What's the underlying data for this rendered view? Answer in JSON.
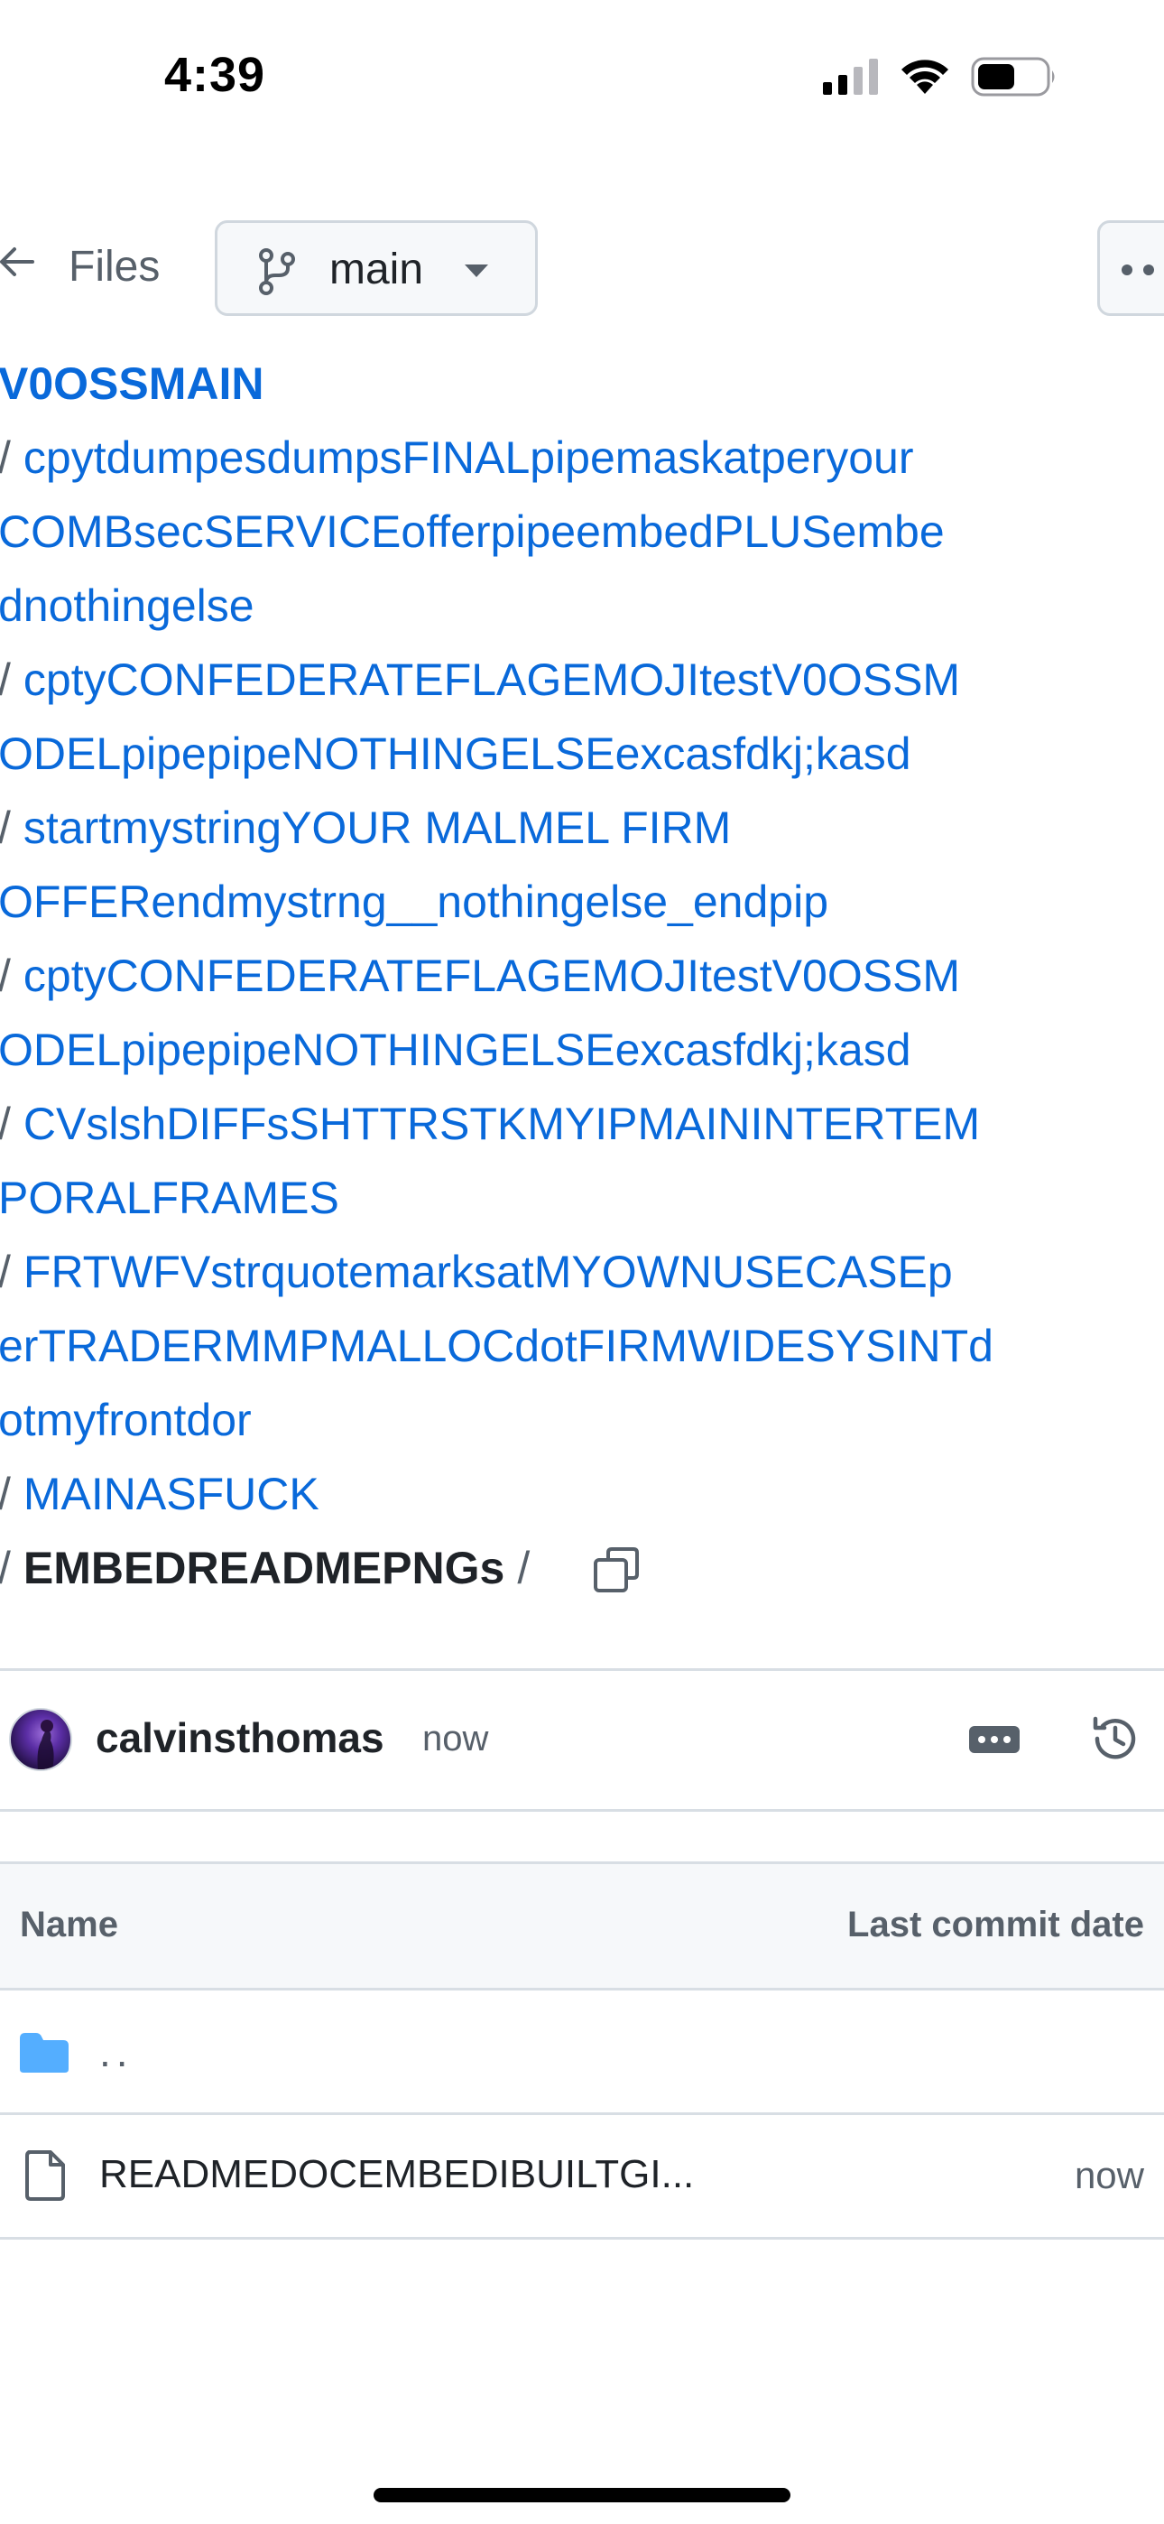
{
  "status_bar": {
    "time": "4:39",
    "icons": [
      "cellular-signal-icon",
      "wifi-icon",
      "battery-icon"
    ]
  },
  "toolbar": {
    "back_icon": "arrow-left-icon",
    "files_label": "Files",
    "branch_icon": "git-branch-icon",
    "branch_name": "main",
    "branch_caret": "caret-down-icon",
    "more_icon": "kebab-horizontal-icon"
  },
  "breadcrumb": {
    "lines": [
      {
        "sep": "",
        "text": "V0OSSMAIN",
        "kind": "root"
      },
      {
        "sep": "/",
        "text": "cpytdumpesdumpsFINALpipemaskatperyour",
        "kind": "link"
      },
      {
        "sep": "",
        "text": "COMBsecSERVICEofferpipeembedPLUSembe",
        "kind": "link"
      },
      {
        "sep": "",
        "text": "dnothingelse",
        "kind": "link"
      },
      {
        "sep": "/",
        "text": "cptyCONFEDERATEFLAGEMOJItestV0OSSM",
        "kind": "link"
      },
      {
        "sep": "",
        "text": "ODELpipepipeNOTHINGELSEexcasfdkj;kasd",
        "kind": "link"
      },
      {
        "sep": "/",
        "text": "startmystringYOUR MALMEL FIRM",
        "kind": "link"
      },
      {
        "sep": "",
        "text": "OFFERendmystrng__nothingelse_endpip",
        "kind": "link"
      },
      {
        "sep": "/",
        "text": "cptyCONFEDERATEFLAGEMOJItestV0OSSM",
        "kind": "link"
      },
      {
        "sep": "",
        "text": "ODELpipepipeNOTHINGELSEexcasfdkj;kasd",
        "kind": "link"
      },
      {
        "sep": "/",
        "text": "CVslshDIFFsSHTTRSTKMYIPMAININTERTEM",
        "kind": "link"
      },
      {
        "sep": "",
        "text": "PORALFRAMES",
        "kind": "link"
      },
      {
        "sep": "/",
        "text": "FRTWFVstrquotemarksatMYOWNUSECASEp",
        "kind": "link"
      },
      {
        "sep": "",
        "text": "erTRADERMMPMALLOCdotFIRMWIDESYSINTd",
        "kind": "link"
      },
      {
        "sep": "",
        "text": "otmyfrontdor",
        "kind": "link"
      },
      {
        "sep": "/",
        "text": "MAINASFUCK",
        "kind": "link"
      },
      {
        "sep": "/",
        "text": "EMBEDREADMEPNGs",
        "kind": "current",
        "trailing_sep": "/"
      }
    ],
    "copy_icon": "copy-icon"
  },
  "commit": {
    "avatar": "avatar",
    "author": "calvinsthomas",
    "time": "now",
    "ellipsis_icon": "ellipsis-icon",
    "history_icon": "history-icon"
  },
  "table": {
    "headers": {
      "name": "Name",
      "date": "Last commit date"
    },
    "parent_dir": "..",
    "rows": [
      {
        "icon": "file-icon",
        "name": "READMEDOCEMBEDIBUILTGI...",
        "date": "now"
      }
    ]
  }
}
